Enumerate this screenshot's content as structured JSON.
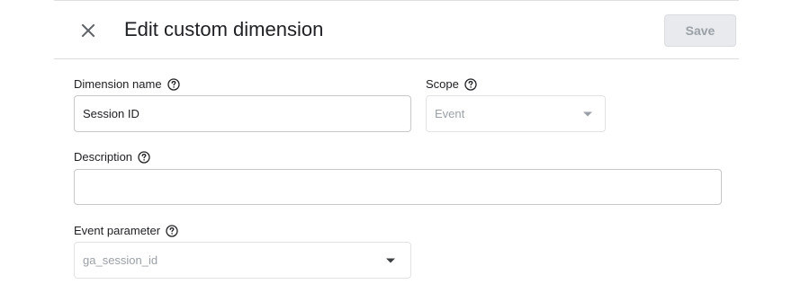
{
  "dialog": {
    "title": "Edit custom dimension",
    "save_label": "Save",
    "close_icon": "close-icon"
  },
  "form": {
    "dimension_name": {
      "label": "Dimension name",
      "value": "Session ID"
    },
    "scope": {
      "label": "Scope",
      "selected": "Event",
      "disabled": true
    },
    "description": {
      "label": "Description",
      "value": ""
    },
    "event_parameter": {
      "label": "Event parameter",
      "selected": "ga_session_id",
      "disabled": true
    }
  },
  "colors": {
    "caret_dark": "#3c4043",
    "caret_disabled": "#9aa0a6",
    "save_disabled_bg": "#e8eaed",
    "save_disabled_text": "#9aa0a6"
  }
}
